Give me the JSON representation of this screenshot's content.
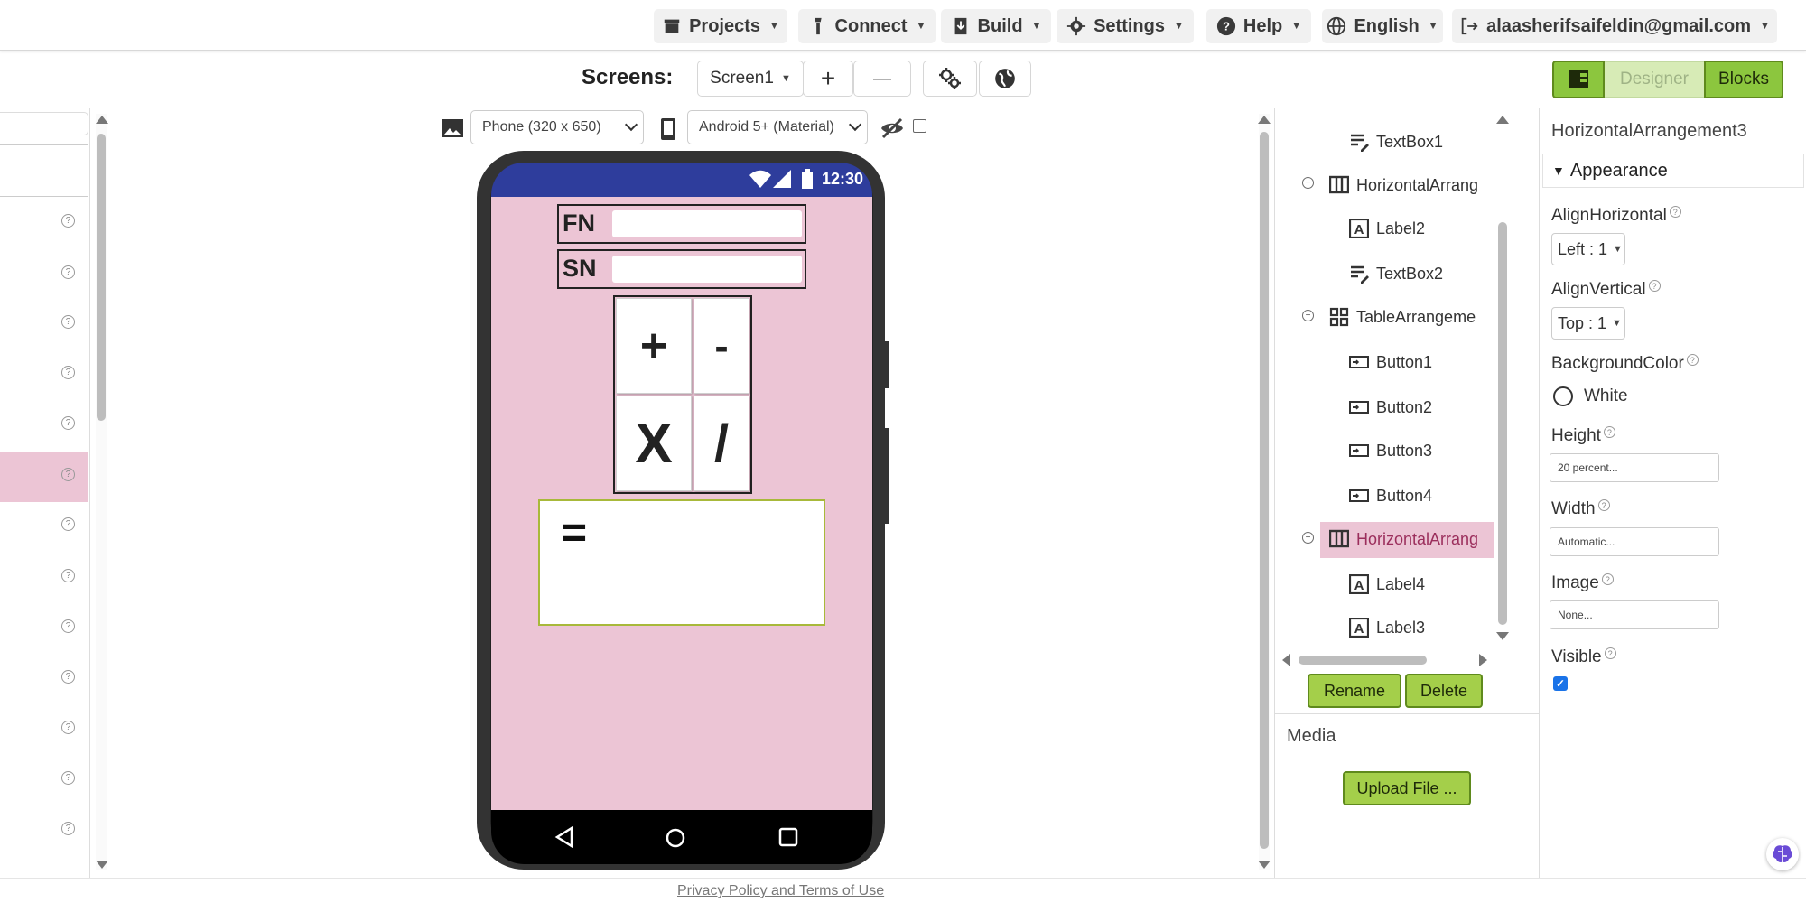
{
  "topbar": {
    "menus": [
      {
        "label": "Projects",
        "icon": "folder-icon"
      },
      {
        "label": "Connect",
        "icon": "connect-icon"
      },
      {
        "label": "Build",
        "icon": "build-icon"
      },
      {
        "label": "Settings",
        "icon": "gear-icon"
      },
      {
        "label": "Help",
        "icon": "help-icon"
      },
      {
        "label": "English",
        "icon": "globe-icon"
      },
      {
        "label": "alaasherifsaifeldin@gmail.com",
        "icon": "logout-icon"
      }
    ]
  },
  "screens": {
    "label": "Screens:",
    "current": "Screen1",
    "add": "+",
    "remove": "—",
    "designer_label": "Designer",
    "blocks_label": "Blocks"
  },
  "viewer": {
    "device": "Phone (320 x 650)",
    "theme": "Android 5+ (Material)",
    "status_time": "12:30",
    "fn_label": "FN",
    "sn_label": "SN",
    "buttons": [
      "+",
      "-",
      "X",
      "/"
    ],
    "result_label": "="
  },
  "components": {
    "items": [
      {
        "label": "TextBox1",
        "icon": "textbox-icon",
        "level": 2
      },
      {
        "label": "HorizontalArrang",
        "icon": "horizontal-arrangement-icon",
        "level": 1
      },
      {
        "label": "Label2",
        "icon": "label-icon",
        "level": 2
      },
      {
        "label": "TextBox2",
        "icon": "textbox-icon",
        "level": 2
      },
      {
        "label": "TableArrangeme",
        "icon": "table-arrangement-icon",
        "level": 1
      },
      {
        "label": "Button1",
        "icon": "button-icon",
        "level": 2
      },
      {
        "label": "Button2",
        "icon": "button-icon",
        "level": 2
      },
      {
        "label": "Button3",
        "icon": "button-icon",
        "level": 2
      },
      {
        "label": "Button4",
        "icon": "button-icon",
        "level": 2
      },
      {
        "label": "HorizontalArrang",
        "icon": "horizontal-arrangement-icon",
        "level": 1,
        "selected": true
      },
      {
        "label": "Label4",
        "icon": "label-icon",
        "level": 2
      },
      {
        "label": "Label3",
        "icon": "label-icon",
        "level": 2
      }
    ],
    "rename_label": "Rename",
    "delete_label": "Delete",
    "media_title": "Media",
    "upload_label": "Upload File ..."
  },
  "properties": {
    "component_name": "HorizontalArrangement3",
    "section": "Appearance",
    "align_horizontal_label": "AlignHorizontal",
    "align_horizontal_value": "Left : 1",
    "align_vertical_label": "AlignVertical",
    "align_vertical_value": "Top : 1",
    "background_color_label": "BackgroundColor",
    "background_color_value": "White",
    "height_label": "Height",
    "height_value": "20 percent...",
    "width_label": "Width",
    "width_value": "Automatic...",
    "image_label": "Image",
    "image_value": "None...",
    "visible_label": "Visible",
    "visible_checked": true
  },
  "footer": {
    "privacy": "Privacy Policy and Terms of Use"
  },
  "colors": {
    "accent_green": "#a4cf4a",
    "phone_screen": "#ecc5d5",
    "status_bar": "#2e3d9c",
    "selected_row": "#ecc5d5"
  }
}
